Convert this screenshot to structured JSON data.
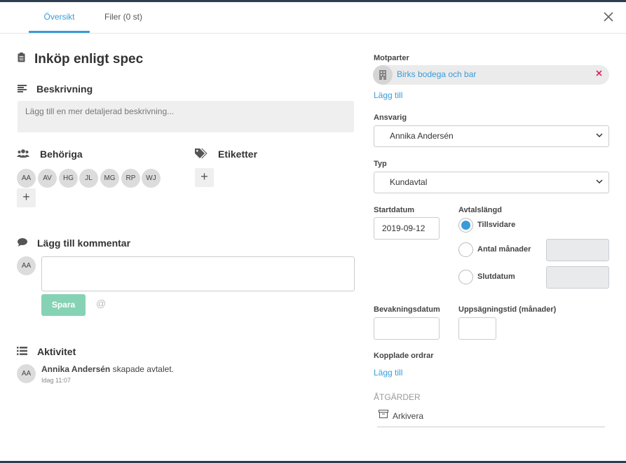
{
  "tabs": [
    {
      "label": "Översikt",
      "active": true
    },
    {
      "label": "Filer (0 st)",
      "active": false
    }
  ],
  "title": "Inköp enligt spec",
  "description": {
    "heading": "Beskrivning",
    "placeholder": "Lägg till en mer detaljerad beskrivning..."
  },
  "members": {
    "heading": "Behöriga",
    "initials": [
      "AA",
      "AV",
      "HG",
      "JL",
      "MG",
      "RP",
      "WJ"
    ],
    "add_label": "+"
  },
  "tags": {
    "heading": "Etiketter",
    "add_label": "+"
  },
  "comment": {
    "heading": "Lägg till kommentar",
    "user_initials": "AA",
    "save_label": "Spara",
    "mention_symbol": "@"
  },
  "activity": {
    "heading": "Aktivitet",
    "items": [
      {
        "initials": "AA",
        "user": "Annika Andersén",
        "action": "skapade avtalet.",
        "time": "Idag 11:07"
      }
    ]
  },
  "counterparties": {
    "label": "Motparter",
    "items": [
      "Birks bodega och bar"
    ],
    "add_label": "Lägg till"
  },
  "responsible": {
    "label": "Ansvarig",
    "value": "Annika Andersén"
  },
  "type": {
    "label": "Typ",
    "value": "Kundavtal"
  },
  "start_date": {
    "label": "Startdatum",
    "value": "2019-09-12"
  },
  "duration": {
    "label": "Avtalslängd",
    "options": [
      {
        "label": "Tillsvidare",
        "checked": true
      },
      {
        "label": "Antal månader",
        "checked": false
      },
      {
        "label": "Slutdatum",
        "checked": false
      }
    ]
  },
  "watch_date": {
    "label": "Bevakningsdatum",
    "value": ""
  },
  "notice_period": {
    "label": "Uppsägningstid (månader)",
    "value": ""
  },
  "linked_orders": {
    "label": "Kopplade ordrar",
    "add_label": "Lägg till"
  },
  "actions": {
    "heading": "ÅTGÄRDER",
    "archive_label": "Arkivera"
  },
  "colors": {
    "accent": "#3a9bd9",
    "save": "#86d2b4",
    "remove": "#e0245e"
  }
}
